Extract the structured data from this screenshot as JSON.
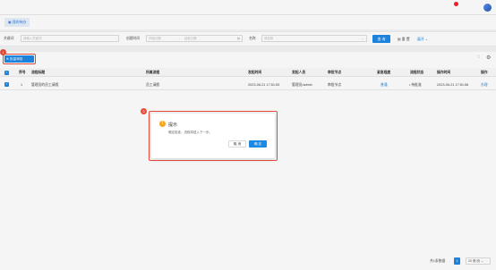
{
  "topbar": {
    "search_label": "搜索"
  },
  "tabs": [
    {
      "label": "我的待办"
    }
  ],
  "filters": {
    "task_type_label": "关键词",
    "task_type_placeholder": "请输入关键词",
    "time_label": "创建时间",
    "time_start_placeholder": "开始日期",
    "time_sep": "→",
    "time_end_placeholder": "结束日期",
    "name_label": "名称",
    "name_placeholder": "请选择",
    "search_btn": "查 询",
    "reset_btn": "重 置",
    "more_btn": "展开"
  },
  "toolbar": {
    "add_label": "批量审批",
    "marker_1": "1"
  },
  "table": {
    "headers": [
      "序号",
      "流程标题",
      "所属流程",
      "发起时间",
      "发起人员",
      "审批节点",
      "紧急程度",
      "流程状态",
      "操作时间",
      "操作"
    ],
    "rows": [
      [
        "1",
        "管理员的员工请假",
        "员工请假",
        "2023-06-21 17:51:53",
        "管理员/admin",
        "审批节点",
        "普通",
        "• 待批准",
        "2023-06-21 17:51:56",
        "办理"
      ]
    ]
  },
  "dialog": {
    "marker_2": "2",
    "title": "提示",
    "message": "确定批准，流程将进入下一步。",
    "cancel": "取 消",
    "ok": "确 定"
  },
  "pagination": {
    "total": "共1条数据",
    "current": "1",
    "page_size": "20 条/页"
  }
}
